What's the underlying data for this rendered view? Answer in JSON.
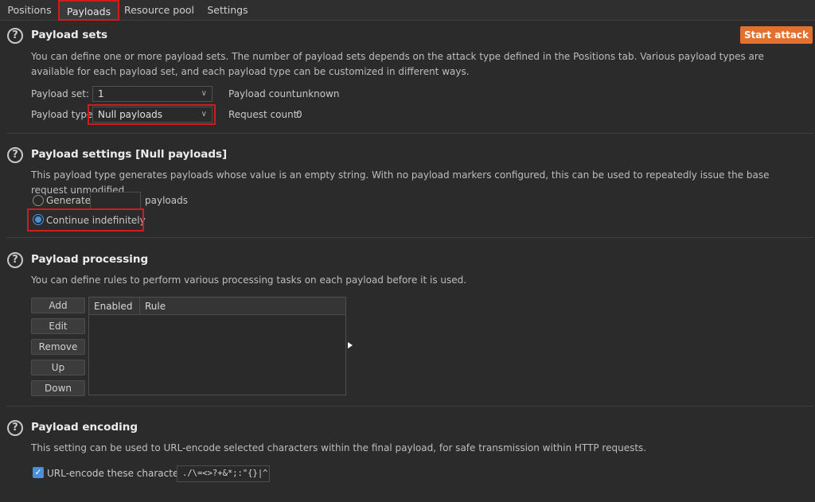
{
  "tabs": [
    {
      "label": "Positions"
    },
    {
      "label": "Payloads"
    },
    {
      "label": "Resource pool"
    },
    {
      "label": "Settings"
    }
  ],
  "help_glyph": "?",
  "start_attack_label": "Start attack",
  "start_attack_color": "#e2712f",
  "highlight_color": "#d01c1c",
  "payload_sets": {
    "title": "Payload sets",
    "description": "You can define one or more payload sets. The number of payload sets depends on the attack type defined in the Positions tab. Various payload types are available for each payload set, and each payload type can be customized in different ways.",
    "set_label": "Payload set:",
    "set_value": "1",
    "type_label": "Payload type",
    "type_value": "Null payloads",
    "count_label": "Payload count:",
    "count_value": "unknown",
    "request_label": "Request count:",
    "request_value": "0"
  },
  "payload_settings": {
    "title": "Payload settings [Null payloads]",
    "description": "This payload type generates payloads whose value is an empty string. With no payload markers configured, this can be used to repeatedly issue the base request unmodified.",
    "generate_label": "Generate",
    "generate_value": "",
    "payloads_suffix": "payloads",
    "continue_label": "Continue indefinitely",
    "selected_option": "Continue indefinitely"
  },
  "payload_processing": {
    "title": "Payload processing",
    "description": "You can define rules to perform various processing tasks on each payload before it is used.",
    "buttons": [
      "Add",
      "Edit",
      "Remove",
      "Up",
      "Down"
    ],
    "columns": [
      "Enabled",
      "Rule"
    ],
    "rows": []
  },
  "payload_encoding": {
    "title": "Payload encoding",
    "description": "This setting can be used to URL-encode selected characters within the final payload, for safe transmission within HTTP requests.",
    "checkbox_label": "URL-encode these characters:",
    "checkbox_checked": true,
    "characters": "./\\=<>?+&*;:\"{}|^`#"
  }
}
